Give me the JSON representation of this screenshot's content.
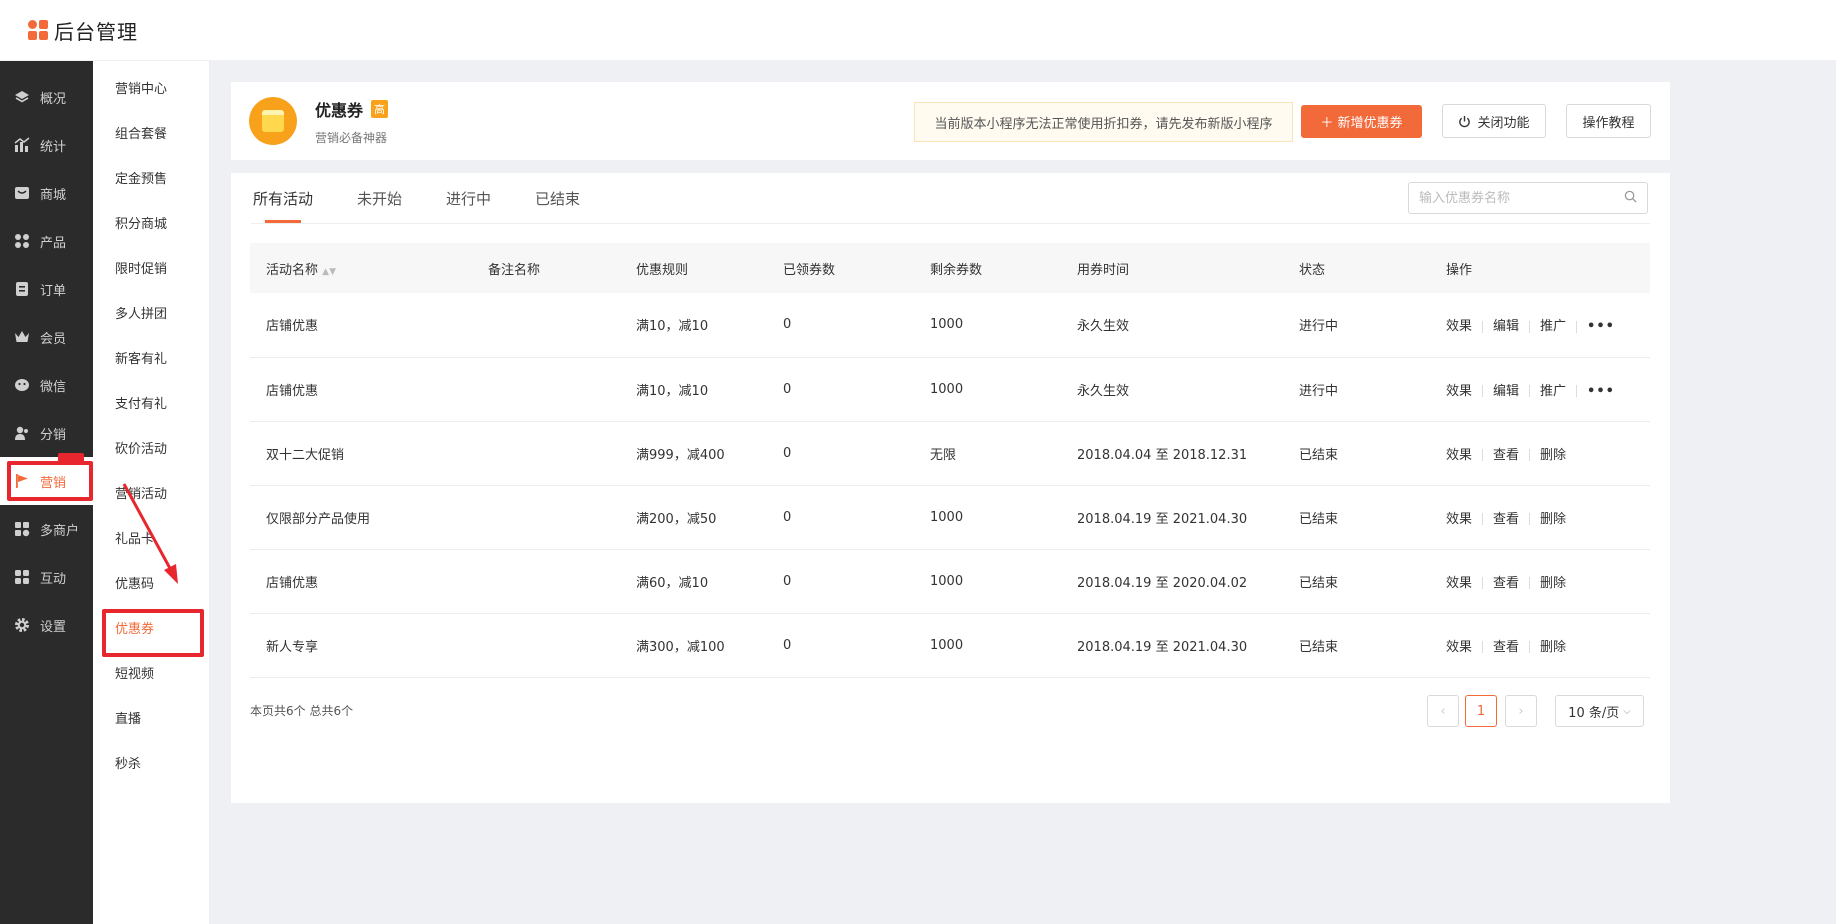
{
  "app": {
    "title": "后台管理"
  },
  "sidebar": {
    "items": [
      {
        "label": "概况",
        "icon": "layers-icon"
      },
      {
        "label": "统计",
        "icon": "chart-icon"
      },
      {
        "label": "商城",
        "icon": "store-icon"
      },
      {
        "label": "产品",
        "icon": "grid-icon"
      },
      {
        "label": "订单",
        "icon": "order-icon"
      },
      {
        "label": "会员",
        "icon": "crown-icon"
      },
      {
        "label": "微信",
        "icon": "wechat-icon"
      },
      {
        "label": "分销",
        "icon": "users-icon"
      },
      {
        "label": "营销",
        "icon": "flag-icon"
      },
      {
        "label": "多商户",
        "icon": "merchant-icon"
      },
      {
        "label": "互动",
        "icon": "apps-icon"
      },
      {
        "label": "设置",
        "icon": "gear-icon"
      }
    ],
    "active": "营销"
  },
  "submenu": {
    "items": [
      "营销中心",
      "组合套餐",
      "定金预售",
      "积分商城",
      "限时促销",
      "多人拼团",
      "新客有礼",
      "支付有礼",
      "砍价活动",
      "营销活动",
      "礼品卡",
      "优惠码",
      "优惠券",
      "短视频",
      "直播",
      "秒杀"
    ],
    "active": "优惠券"
  },
  "header": {
    "title": "优惠券",
    "badge": "高",
    "subtitle": "营销必备神器",
    "notice": "当前版本小程序无法正常使用折扣券，请先发布新版小程序",
    "add_button": "＋  新增优惠券",
    "close_button": "关闭功能",
    "tutorial_button": "操作教程"
  },
  "tabs": [
    "所有活动",
    "未开始",
    "进行中",
    "已结束"
  ],
  "active_tab": "所有活动",
  "search": {
    "placeholder": "输入优惠券名称",
    "value": ""
  },
  "table": {
    "columns": [
      "活动名称",
      "备注名称",
      "优惠规则",
      "已领券数",
      "剩余券数",
      "用券时间",
      "状态",
      "操作"
    ],
    "rows": [
      {
        "name": "店铺优惠",
        "note": "",
        "rule": "满10，减10",
        "claimed": "0",
        "remaining": "1000",
        "time": "永久生效",
        "status": "进行中",
        "actions": [
          "效果",
          "编辑",
          "推广"
        ],
        "more": "•••"
      },
      {
        "name": "店铺优惠",
        "note": "",
        "rule": "满10，减10",
        "claimed": "0",
        "remaining": "1000",
        "time": "永久生效",
        "status": "进行中",
        "actions": [
          "效果",
          "编辑",
          "推广"
        ],
        "more": "•••"
      },
      {
        "name": "双十二大促销",
        "note": "",
        "rule": "满999，减400",
        "claimed": "0",
        "remaining": "无限",
        "time": "2018.04.04 至 2018.12.31",
        "status": "已结束",
        "actions": [
          "效果",
          "查看",
          "删除"
        ],
        "more": ""
      },
      {
        "name": "仅限部分产品使用",
        "note": "",
        "rule": "满200，减50",
        "claimed": "0",
        "remaining": "1000",
        "time": "2018.04.19 至 2021.04.30",
        "status": "已结束",
        "actions": [
          "效果",
          "查看",
          "删除"
        ],
        "more": ""
      },
      {
        "name": "店铺优惠",
        "note": "",
        "rule": "满60，减10",
        "claimed": "0",
        "remaining": "1000",
        "time": "2018.04.19 至 2020.04.02",
        "status": "已结束",
        "actions": [
          "效果",
          "查看",
          "删除"
        ],
        "more": ""
      },
      {
        "name": "新人专享",
        "note": "",
        "rule": "满300，减100",
        "claimed": "0",
        "remaining": "1000",
        "time": "2018.04.19 至 2021.04.30",
        "status": "已结束",
        "actions": [
          "效果",
          "查看",
          "删除"
        ],
        "more": ""
      }
    ]
  },
  "footer": {
    "count_text": "本页共6个 总共6个"
  },
  "pagination": {
    "prev": "‹",
    "current": "1",
    "next": "›",
    "page_size": "10 条/页"
  },
  "colors": {
    "accent": "#f26a3a",
    "highlight": "#e8262e",
    "sidebar": "#2b2b2b"
  }
}
